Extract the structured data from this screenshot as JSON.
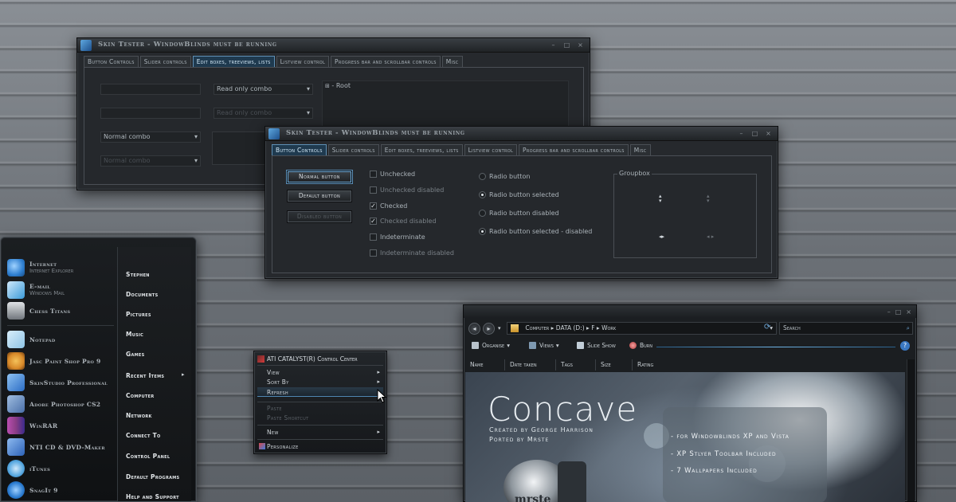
{
  "tester_title": "Skin Tester - WindowBlinds must be running",
  "tester_tabs": [
    "Button Controls",
    "Slider controls",
    "Edit boxes, treeviews, lists",
    "Listview control",
    "Progress bar and scrollbar controls",
    "Misc"
  ],
  "edit_panel": {
    "readonly_combo": "Read only combo",
    "readonly_combo_disabled": "Read only combo",
    "normal_combo": "Normal combo",
    "normal_combo_disabled": "Normal combo",
    "tree_root": "Root"
  },
  "button_panel": {
    "normal_button": "Normal button",
    "default_button": "Default button",
    "disabled_button": "Disabled button",
    "checkboxes": [
      {
        "label": "Unchecked",
        "checked": false
      },
      {
        "label": "Unchecked disabled",
        "checked": false
      },
      {
        "label": "Checked",
        "checked": true
      },
      {
        "label": "Checked disabled",
        "checked": true
      },
      {
        "label": "Indeterminate",
        "checked": false
      },
      {
        "label": "Indeterminate disabled",
        "checked": false
      }
    ],
    "radios": [
      {
        "label": "Radio button",
        "selected": false
      },
      {
        "label": "Radio button selected",
        "selected": true
      },
      {
        "label": "Radio button disabled",
        "selected": false
      },
      {
        "label": "Radio button selected - disabled",
        "selected": true
      }
    ],
    "groupbox": "Groupbox"
  },
  "start_menu": {
    "pinned": [
      {
        "title": "Internet",
        "subtitle": "Internet Explorer",
        "color": "#2f7fd0"
      },
      {
        "title": "E-mail",
        "subtitle": "Windows Mail",
        "color": "#3a9ad8"
      },
      {
        "title": "Chess Titans",
        "subtitle": "",
        "color": "#a0a6ac"
      }
    ],
    "recent": [
      {
        "title": "Notepad",
        "color": "#8fc4e6"
      },
      {
        "title": "Jasc Paint Shop Pro 9",
        "color": "#d88a2a"
      },
      {
        "title": "SkinStudio Professional",
        "color": "#2b6cc4"
      },
      {
        "title": "Adobe Photoshop CS2",
        "color": "#4a6fa8"
      },
      {
        "title": "WinRAR",
        "color": "#8a3d86"
      },
      {
        "title": "NTI CD & DVD-Maker",
        "color": "#2d63b8"
      },
      {
        "title": "iTunes",
        "color": "#56a7e0"
      },
      {
        "title": "SnagIt 9",
        "color": "#2a7bd0"
      }
    ],
    "right": [
      "Stephen",
      "Documents",
      "Pictures",
      "Music",
      "Games",
      "Recent Items",
      "Computer",
      "Network",
      "Connect To",
      "Control Panel",
      "Default Programs",
      "Help and Support"
    ]
  },
  "context_menu": {
    "title": "ATI CATALYST(R) Control Center",
    "items": [
      "View",
      "Sort By",
      "Refresh",
      "Paste",
      "Paste Shortcut",
      "New",
      "Personalize"
    ]
  },
  "explorer": {
    "breadcrumb": [
      "Computer",
      "DATA (D:)",
      "F",
      "Work"
    ],
    "search": "Search",
    "toolbar": [
      "Organise",
      "Views",
      "Slide Show",
      "Burn"
    ],
    "columns": [
      "Name",
      "Date taken",
      "Tags",
      "Size",
      "Rating"
    ]
  },
  "wallpaper": {
    "title": "Concave",
    "credit1": "Created by George Harrison",
    "credit2": "Ported by Mrste",
    "features": [
      "- for Windowblinds XP and Vista",
      "- XP Stlyer Toolbar Included",
      "- 7 Wallpapers Included"
    ],
    "logo": "mrste"
  }
}
